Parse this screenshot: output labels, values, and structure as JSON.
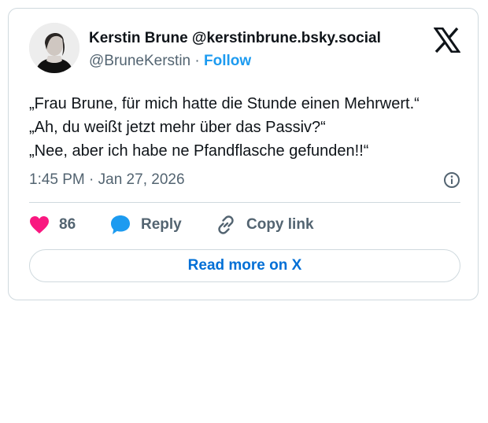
{
  "author": {
    "display_name": "Kerstin Brune @kerstinbrune.bsky.social",
    "handle": "@BruneKerstin",
    "separator": " · ",
    "follow_label": "Follow"
  },
  "tweet": {
    "lines": [
      "„Frau Brune, für mich hatte die Stunde einen Mehrwert.“",
      "„Ah, du weißt jetzt mehr über das Passiv?“",
      "„Nee, aber ich habe ne Pfandflasche gefunden!!“"
    ],
    "timestamp": "1:45 PM · Jan 27, 2026"
  },
  "actions": {
    "like_count": "86",
    "reply_label": "Reply",
    "copy_link_label": "Copy link"
  },
  "read_more_label": "Read more on X",
  "icons": {
    "brand": "x-logo-icon",
    "like": "heart-icon",
    "reply": "speech-bubble-icon",
    "copy": "link-icon",
    "info": "info-icon"
  },
  "colors": {
    "heart": "#f91880",
    "reply_bubble": "#1d9bf0",
    "follow": "#1d9bf0",
    "read_more": "#006fd6",
    "muted_text": "#536471",
    "border": "#cfd9de"
  }
}
